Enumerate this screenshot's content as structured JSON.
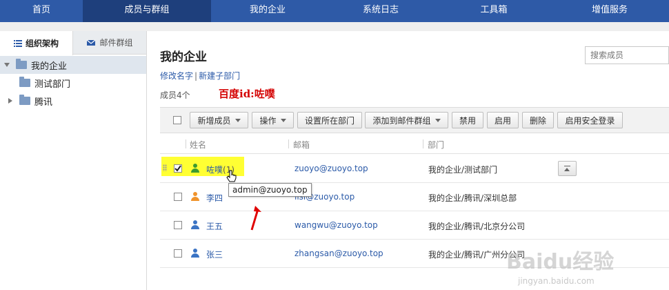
{
  "nav": {
    "items": [
      "首页",
      "成员与群组",
      "我的企业",
      "系统日志",
      "工具箱",
      "增值服务"
    ]
  },
  "sidebar": {
    "tabs": [
      "组织架构",
      "邮件群组"
    ],
    "tree": [
      "我的企业",
      "测试部门",
      "腾讯"
    ]
  },
  "main": {
    "title": "我的企业",
    "search_placeholder": "搜索成员",
    "link_rename": "修改名字",
    "link_sep": "|",
    "link_new_dept": "新建子部门",
    "member_count": "成员4个",
    "annotation": "百度id:咗噗"
  },
  "toolbar": {
    "add_member": "新增成员",
    "operate": "操作",
    "set_dept": "设置所在部门",
    "add_to_group": "添加到邮件群组",
    "disable": "禁用",
    "enable": "启用",
    "delete": "删除",
    "secure_login": "启用安全登录"
  },
  "table": {
    "headers": [
      "姓名",
      "邮箱",
      "部门"
    ],
    "rows": [
      {
        "name": "咗噗",
        "suffix": "(1)",
        "email": "zuoyo@zuoyo.top",
        "dept": "我的企业/测试部门",
        "checked": true,
        "icon_color": "#3c9a2f"
      },
      {
        "name": "李四",
        "suffix": "",
        "email": "lisi@zuoyo.top",
        "dept": "我的企业/腾讯/深圳总部",
        "checked": false,
        "icon_color": "#f0932b"
      },
      {
        "name": "王五",
        "suffix": "",
        "email": "wangwu@zuoyo.top",
        "dept": "我的企业/腾讯/北京分公司",
        "checked": false,
        "icon_color": "#3b74c4"
      },
      {
        "name": "张三",
        "suffix": "",
        "email": "zhangsan@zuoyo.top",
        "dept": "我的企业/腾讯/广州分公司",
        "checked": false,
        "icon_color": "#3b74c4"
      }
    ]
  },
  "tooltip": "admin@zuoyo.top",
  "watermark": {
    "brand": "Baidu经验",
    "url": "jingyan.baidu.com"
  },
  "colors": {
    "nav_bg": "#2e5aa7",
    "nav_active": "#1e3f7c",
    "link": "#2b5aa8",
    "highlight": "#ffff33",
    "arrow": "#e00000"
  },
  "icons": [
    "list-icon",
    "mail-group-icon",
    "folder-icon",
    "caret-down-icon",
    "caret-right-icon",
    "user-icon",
    "move-top-icon",
    "cursor-icon",
    "arrow-icon"
  ]
}
